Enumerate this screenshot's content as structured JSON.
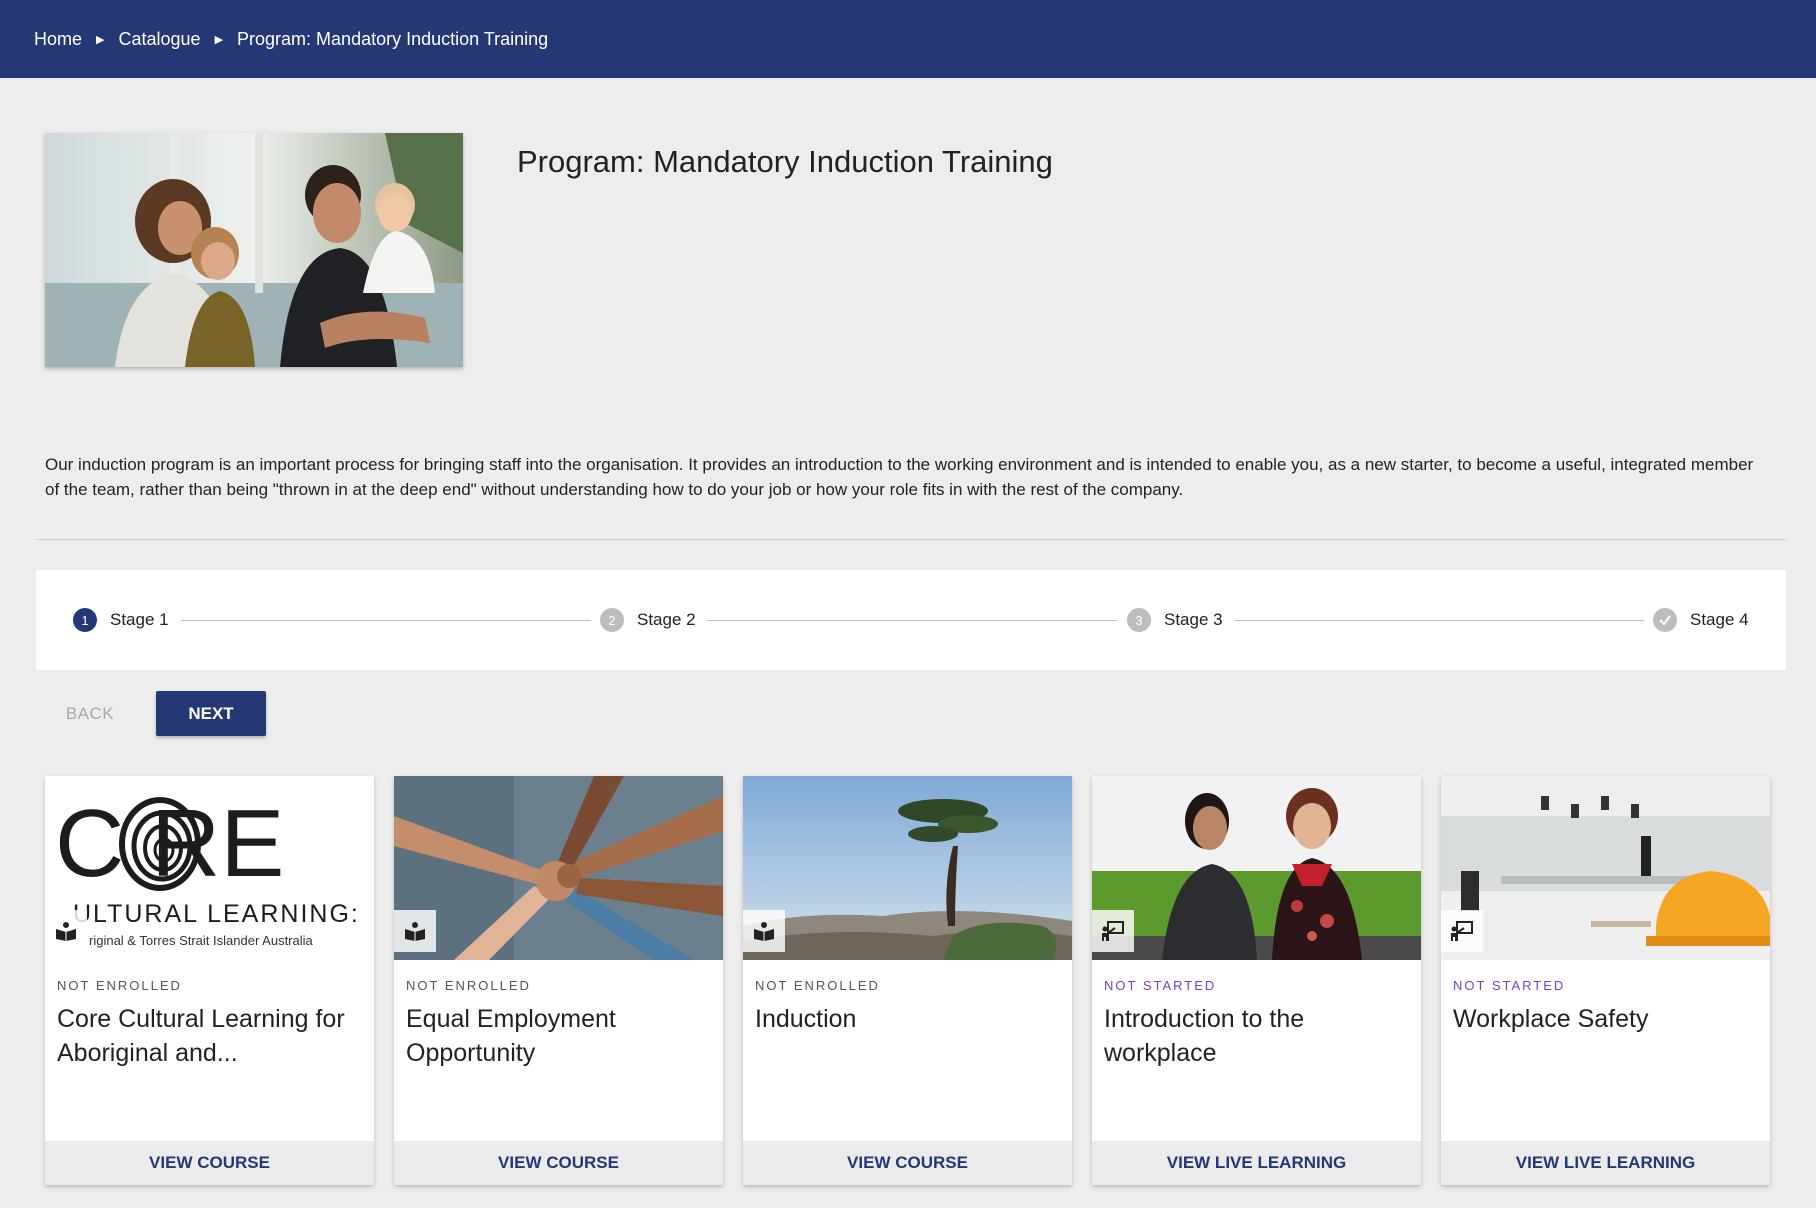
{
  "breadcrumb": {
    "home": "Home",
    "catalogue": "Catalogue",
    "current": "Program: Mandatory Induction Training"
  },
  "program": {
    "title": "Program: Mandatory Induction Training",
    "description": "Our induction program is an important process for bringing staff into the organisation. It provides an introduction to the working environment and is intended to enable you, as a new starter, to become a useful, integrated member of the team, rather than being \"thrown in at the deep end\" without understanding how to do your job or how your role fits in with the rest of the company."
  },
  "stepper": {
    "steps": [
      {
        "number": "1",
        "label": "Stage 1",
        "state": "active"
      },
      {
        "number": "2",
        "label": "Stage 2",
        "state": "inactive"
      },
      {
        "number": "3",
        "label": "Stage 3",
        "state": "inactive"
      },
      {
        "number": "",
        "label": "Stage 4",
        "state": "complete"
      }
    ]
  },
  "nav": {
    "back_label": "BACK",
    "next_label": "NEXT"
  },
  "cards": [
    {
      "status": "NOT ENROLLED",
      "title": "Core Cultural Learning for Aboriginal and...",
      "action": "VIEW COURSE",
      "type_icon": "book-icon",
      "logo": {
        "big": "C RE",
        "line1": "ULTURAL LEARNING:",
        "line2": "riginal & Torres Strait Islander Australia"
      }
    },
    {
      "status": "NOT ENROLLED",
      "title": "Equal Employment Opportunity",
      "action": "VIEW COURSE",
      "type_icon": "book-icon"
    },
    {
      "status": "NOT ENROLLED",
      "title": "Induction",
      "action": "VIEW COURSE",
      "type_icon": "book-icon"
    },
    {
      "status": "NOT STARTED",
      "title": "Introduction to the workplace",
      "action": "VIEW LIVE LEARNING",
      "type_icon": "presenter-icon"
    },
    {
      "status": "NOT STARTED",
      "title": "Workplace Safety",
      "action": "VIEW LIVE LEARNING",
      "type_icon": "presenter-icon"
    }
  ],
  "colors": {
    "brand": "#243876",
    "background": "#ededed",
    "status_not_started": "#7b3fc4",
    "status_not_enrolled": "#555555"
  }
}
